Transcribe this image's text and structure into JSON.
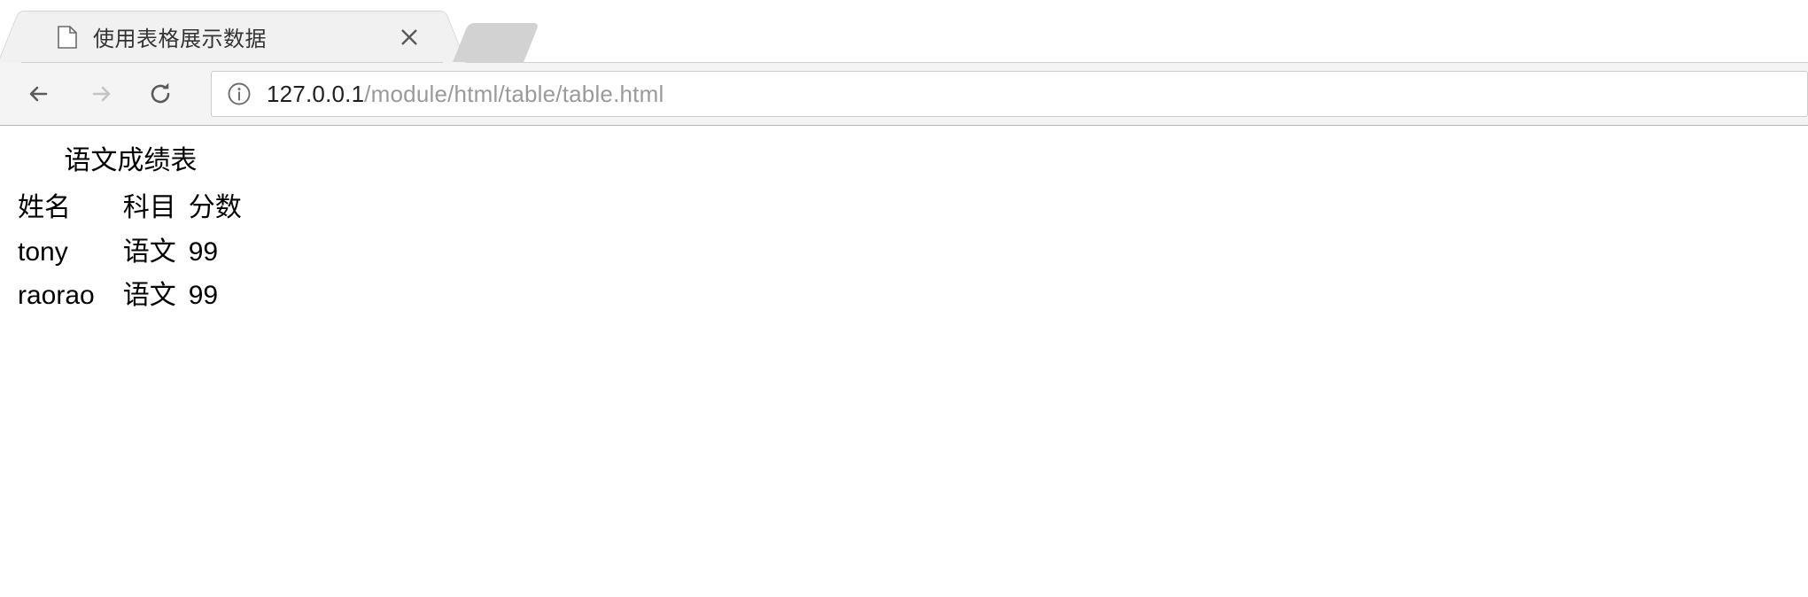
{
  "browser": {
    "tab": {
      "title": "使用表格展示数据",
      "favicon_name": "page-icon",
      "close_label": "×"
    },
    "toolbar": {
      "back_label": "←",
      "forward_label": "→",
      "reload_label": "⟳",
      "security_label": "ⓘ",
      "url_host": "127.0.0.1",
      "url_path": "/module/html/table/table.html",
      "url_full": "127.0.0.1/module/html/table/table.html"
    },
    "colors": {
      "toolbar_bg": "#f4f4f4",
      "tab_bg": "#f1f1f1",
      "ghost_tab": "#d2d2d2",
      "back_arrow": "#5a5a5a",
      "forward_arrow": "#c3c3c3",
      "url_host_text": "#1f1f1f",
      "url_path_text": "#9a9a9a",
      "page_bg": "#ffffff",
      "text": "#000000"
    }
  },
  "page": {
    "table": {
      "caption": "语文成绩表",
      "headers": [
        "姓名",
        "科目",
        "分数"
      ],
      "rows": [
        [
          "tony",
          "语文",
          "99"
        ],
        [
          "raorao",
          "语文",
          "99"
        ]
      ]
    }
  }
}
